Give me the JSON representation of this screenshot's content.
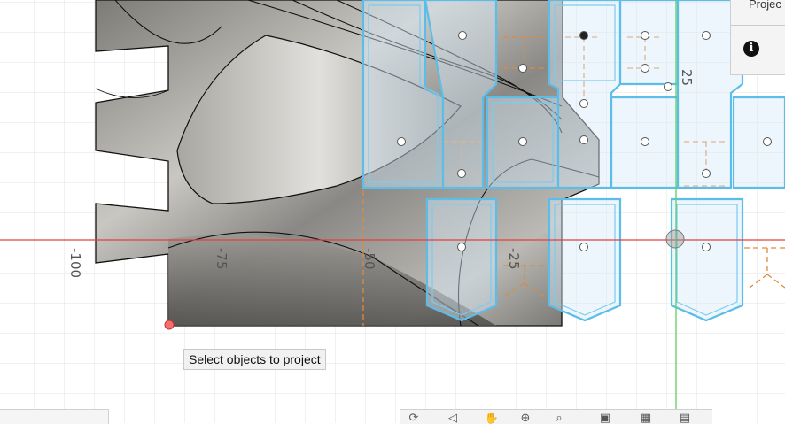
{
  "viewport": {
    "axis_labels": [
      "-100",
      "-75",
      "-50",
      "-25",
      "25"
    ]
  },
  "tooltip": {
    "text": "Select objects to project"
  },
  "project_panel": {
    "title": "Projec",
    "info_icon": "info-icon"
  },
  "navigation_bar": {
    "icons": [
      "orbit-icon",
      "look-at-icon",
      "pan-icon",
      "zoom-icon",
      "zoom-window-icon",
      "display-settings-icon",
      "grid-icon",
      "viewports-icon"
    ]
  },
  "colors": {
    "grid": "#e3e3e3",
    "x_axis": "#e04040",
    "y_axis": "#5ed05e",
    "sketch_blue": "#5cbde8",
    "sketch_fill": "#d8ecf8",
    "construction": "#e08a3c"
  }
}
